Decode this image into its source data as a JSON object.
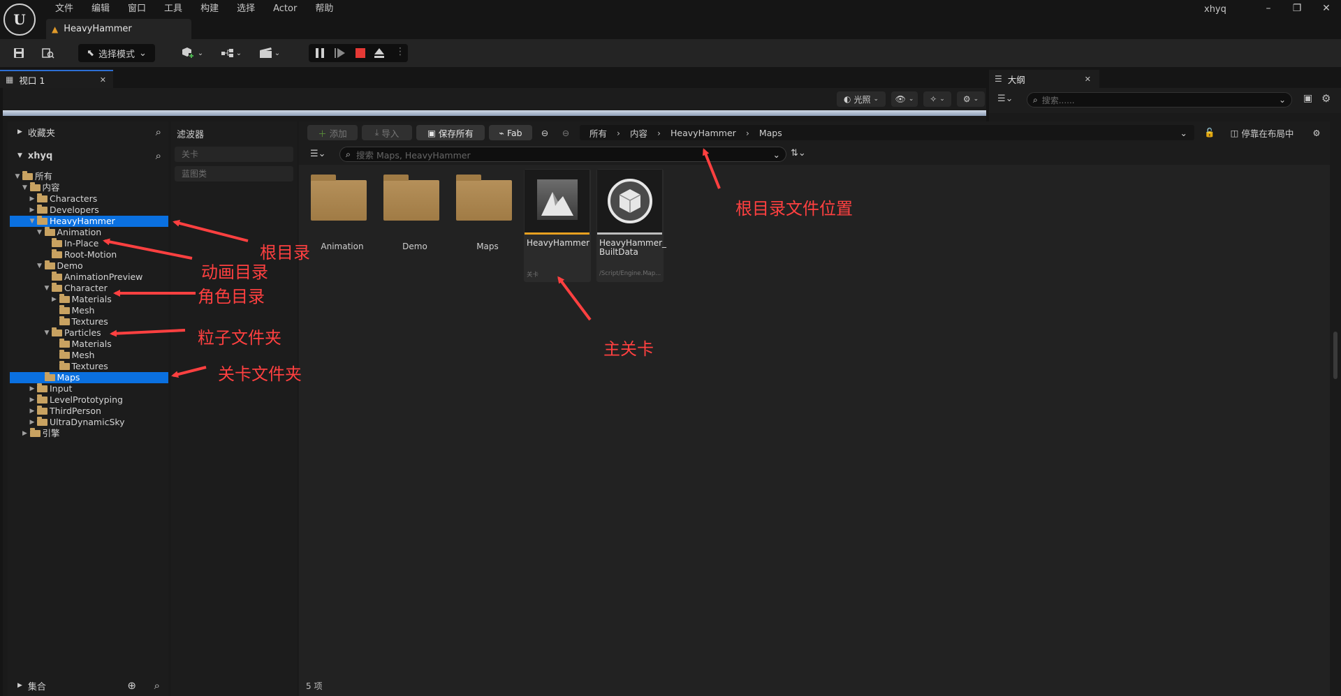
{
  "menubar": {
    "items": [
      "文件",
      "编辑",
      "窗口",
      "工具",
      "构建",
      "选择",
      "Actor",
      "帮助"
    ],
    "user": "xhyq"
  },
  "document_tab": {
    "label": "HeavyHammer"
  },
  "toolbar": {
    "mode_select": "选择模式"
  },
  "viewport": {
    "tab_label": "视口 1",
    "lighting_label": "光照"
  },
  "outliner": {
    "tab_label": "大纲",
    "search_placeholder": "搜索......"
  },
  "sources": {
    "favorites_label": "收藏夹",
    "project_label": "xhyq",
    "collections_label": "集合",
    "tree": [
      {
        "label": "所有",
        "depth": 0,
        "arrow": "open",
        "selected": false
      },
      {
        "label": "内容",
        "depth": 1,
        "arrow": "open",
        "selected": false
      },
      {
        "label": "Characters",
        "depth": 2,
        "arrow": "closed",
        "selected": false
      },
      {
        "label": "Developers",
        "depth": 2,
        "arrow": "closed",
        "selected": false
      },
      {
        "label": "HeavyHammer",
        "depth": 2,
        "arrow": "open",
        "selected": true
      },
      {
        "label": "Animation",
        "depth": 3,
        "arrow": "open",
        "selected": false
      },
      {
        "label": "In-Place",
        "depth": 4,
        "arrow": "none",
        "selected": false
      },
      {
        "label": "Root-Motion",
        "depth": 4,
        "arrow": "none",
        "selected": false
      },
      {
        "label": "Demo",
        "depth": 3,
        "arrow": "open",
        "selected": false
      },
      {
        "label": "AnimationPreview",
        "depth": 4,
        "arrow": "none",
        "selected": false
      },
      {
        "label": "Character",
        "depth": 4,
        "arrow": "open",
        "selected": false
      },
      {
        "label": "Materials",
        "depth": 5,
        "arrow": "closed",
        "selected": false
      },
      {
        "label": "Mesh",
        "depth": 5,
        "arrow": "none",
        "selected": false
      },
      {
        "label": "Textures",
        "depth": 5,
        "arrow": "none",
        "selected": false
      },
      {
        "label": "Particles",
        "depth": 4,
        "arrow": "open",
        "selected": false
      },
      {
        "label": "Materials",
        "depth": 5,
        "arrow": "none",
        "selected": false
      },
      {
        "label": "Mesh",
        "depth": 5,
        "arrow": "none",
        "selected": false
      },
      {
        "label": "Textures",
        "depth": 5,
        "arrow": "none",
        "selected": false
      },
      {
        "label": "Maps",
        "depth": 3,
        "arrow": "none",
        "selected": true
      },
      {
        "label": "Input",
        "depth": 2,
        "arrow": "closed",
        "selected": false
      },
      {
        "label": "LevelPrototyping",
        "depth": 2,
        "arrow": "closed",
        "selected": false
      },
      {
        "label": "ThirdPerson",
        "depth": 2,
        "arrow": "closed",
        "selected": false
      },
      {
        "label": "UltraDynamicSky",
        "depth": 2,
        "arrow": "closed",
        "selected": false
      },
      {
        "label": "引擎",
        "depth": 1,
        "arrow": "closed",
        "selected": false
      }
    ]
  },
  "filters": {
    "title": "滤波器",
    "chips": [
      "关卡",
      "蓝图类"
    ]
  },
  "asset_toolbar": {
    "add_label": "添加",
    "import_label": "导入",
    "save_all_label": "保存所有",
    "fab_label": "Fab",
    "breadcrumb": [
      "所有",
      "内容",
      "HeavyHammer",
      "Maps"
    ],
    "dock_label": "停靠在布局中",
    "search_placeholder": "搜索 Maps, HeavyHammer"
  },
  "assets": {
    "folders": [
      "Animation",
      "Demo",
      "Maps"
    ],
    "cards": [
      {
        "name": "HeavyHammer",
        "type": "关卡",
        "accent": "#e8a020",
        "icon": "level-icon"
      },
      {
        "name": "HeavyHammer_ BuiltData",
        "type": "/Script/Engine.Map...",
        "accent": "#bdbdbd",
        "icon": "builtdata-icon"
      }
    ],
    "count_label": "5 项"
  },
  "annotations": {
    "root_dir": "根目录",
    "anim_dir": "动画目录",
    "character_dir": "角色目录",
    "particles_dir": "粒子文件夹",
    "maps_dir": "关卡文件夹",
    "root_path": "根目录文件位置",
    "main_level": "主关卡",
    "color": "#ff4040"
  }
}
